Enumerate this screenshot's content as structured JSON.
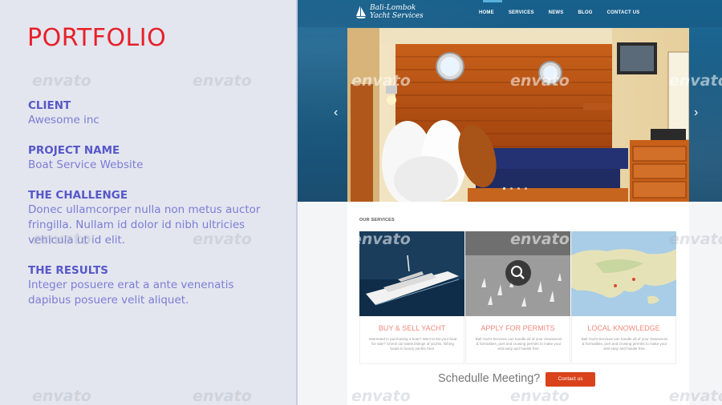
{
  "slide": {
    "title": "PORTFOLIO",
    "sections": [
      {
        "heading": "CLIENT",
        "body": "Awesome inc"
      },
      {
        "heading": "PROJECT NAME",
        "body": "Boat Service Website"
      },
      {
        "heading": "THE CHALLENGE",
        "body": "Donec ullamcorper nulla non metus auctor fringilla. Nullam id dolor id nibh ultricies vehicula ut id elit."
      },
      {
        "heading": "THE RESULTS",
        "body": "Integer posuere erat a ante venenatis dapibus posuere velit aliquet."
      }
    ]
  },
  "site": {
    "logo_line1": "Bali-Lombok",
    "logo_line2": "Yacht Services",
    "nav": [
      "HOME",
      "SERVICES",
      "NEWS",
      "BLOG",
      "CONTACT US"
    ],
    "slider_prev": "‹",
    "slider_next": "›",
    "services_title": "OUR SERVICES",
    "services": [
      {
        "title": "BUY & SELL YACHT",
        "text": "Interested in purchasing a boat? Want to list your boat for sale? Check our latest listings of yachts, fishing boats to luxury yachts here."
      },
      {
        "title": "APPLY FOR PERMITS",
        "text": "Bali Yacht Services can handle all of your clearances & formalities, port and cruising permits to make your visit easy and hassle free."
      },
      {
        "title": "LOCAL KNOWLEDGE",
        "text": "Bali Yacht Services can handle all of your clearances & formalities, port and cruising permits to make your visit easy and hassle free."
      }
    ],
    "cta_text": "Schedulle Meeting?",
    "cta_button": "Contact us"
  },
  "watermark": "envato",
  "colors": {
    "accent": "#e8202a",
    "heading": "#5757c8",
    "body": "#7c7cd4",
    "cta": "#d9421a",
    "nav_bg": "#1b6a98"
  }
}
